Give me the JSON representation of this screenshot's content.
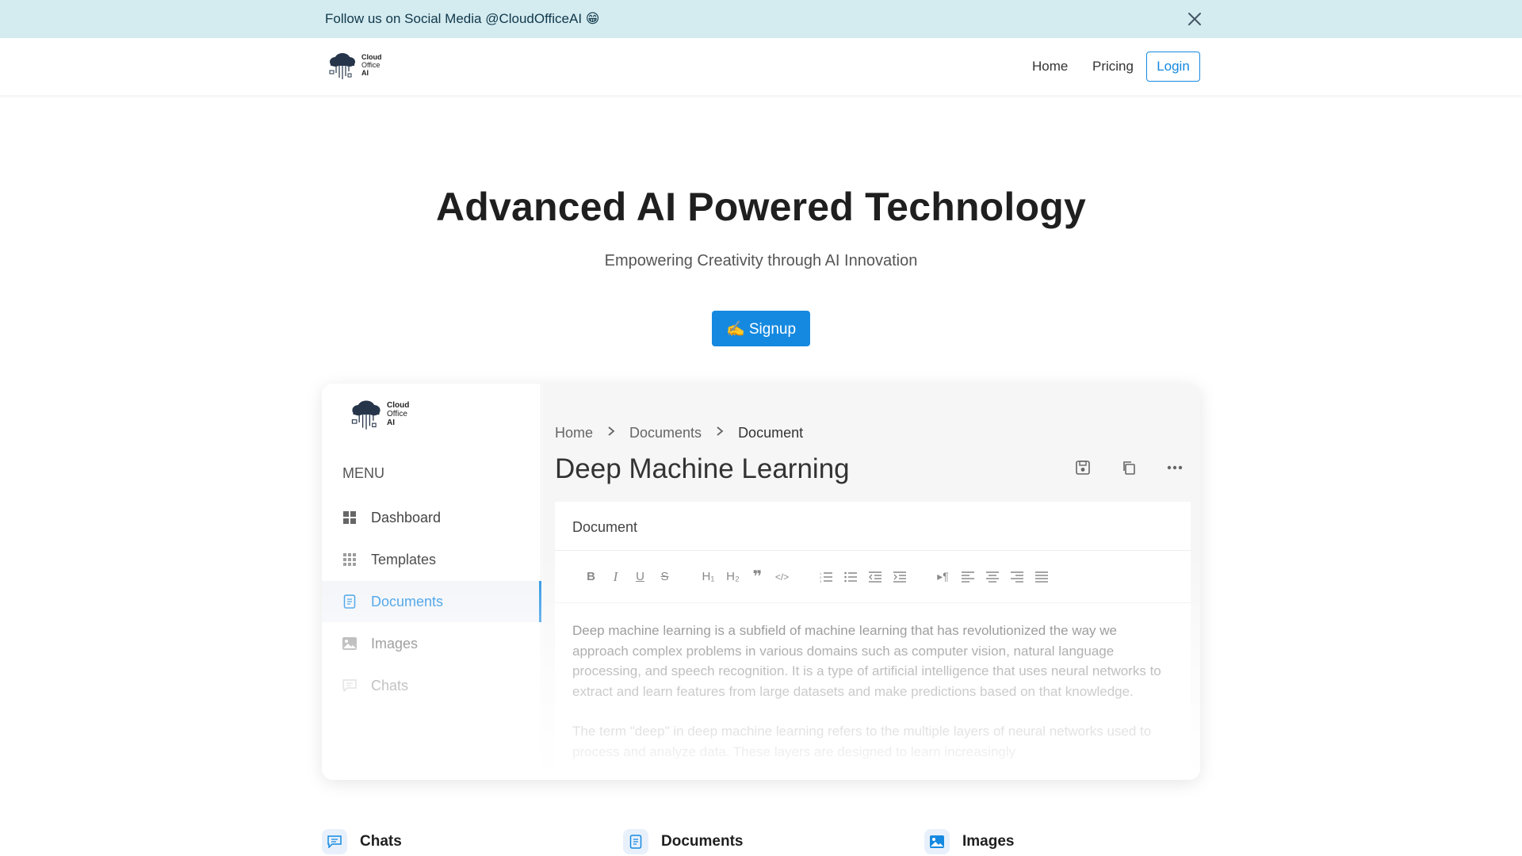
{
  "announcement": {
    "text": "Follow us on Social Media @CloudOfficeAI 😁"
  },
  "brand": {
    "line1": "Cloud",
    "line2": "Office",
    "line3": "AI",
    "accent": "#1589e0"
  },
  "nav": {
    "home": "Home",
    "pricing": "Pricing",
    "login": "Login"
  },
  "hero": {
    "title": "Advanced AI Powered Technology",
    "subtitle": "Empowering Creativity through AI Innovation",
    "cta": "✍️ Signup"
  },
  "preview": {
    "menu_label": "MENU",
    "menu": [
      {
        "label": "Dashboard",
        "icon": "dashboard-icon"
      },
      {
        "label": "Templates",
        "icon": "templates-icon"
      },
      {
        "label": "Documents",
        "icon": "document-icon",
        "active": true
      },
      {
        "label": "Images",
        "icon": "image-icon"
      },
      {
        "label": "Chats",
        "icon": "chat-icon"
      }
    ],
    "breadcrumb": [
      "Home",
      "Documents",
      "Document"
    ],
    "title": "Deep Machine Learning",
    "card_title": "Document",
    "toolbar": [
      "B",
      "I",
      "U",
      "S",
      "H1",
      "H2",
      "quote",
      "code",
      "ordered-list",
      "bullet-list",
      "outdent",
      "indent",
      "rtl",
      "align-left",
      "align-center",
      "align-right",
      "justify"
    ],
    "paragraphs": [
      "Deep machine learning is a subfield of machine learning that has revolutionized the way we approach complex problems in various domains such as computer vision, natural language processing, and speech recognition. It is a type of artificial intelligence that uses neural networks to extract and learn features from large datasets and make predictions based on that knowledge.",
      "The term \"deep\" in deep machine learning refers to the multiple layers of neural networks used to process and analyze data. These layers are designed to learn increasingly"
    ]
  },
  "features": [
    {
      "label": "Chats",
      "icon": "chat-icon"
    },
    {
      "label": "Documents",
      "icon": "document-icon"
    },
    {
      "label": "Images",
      "icon": "image-icon"
    }
  ]
}
